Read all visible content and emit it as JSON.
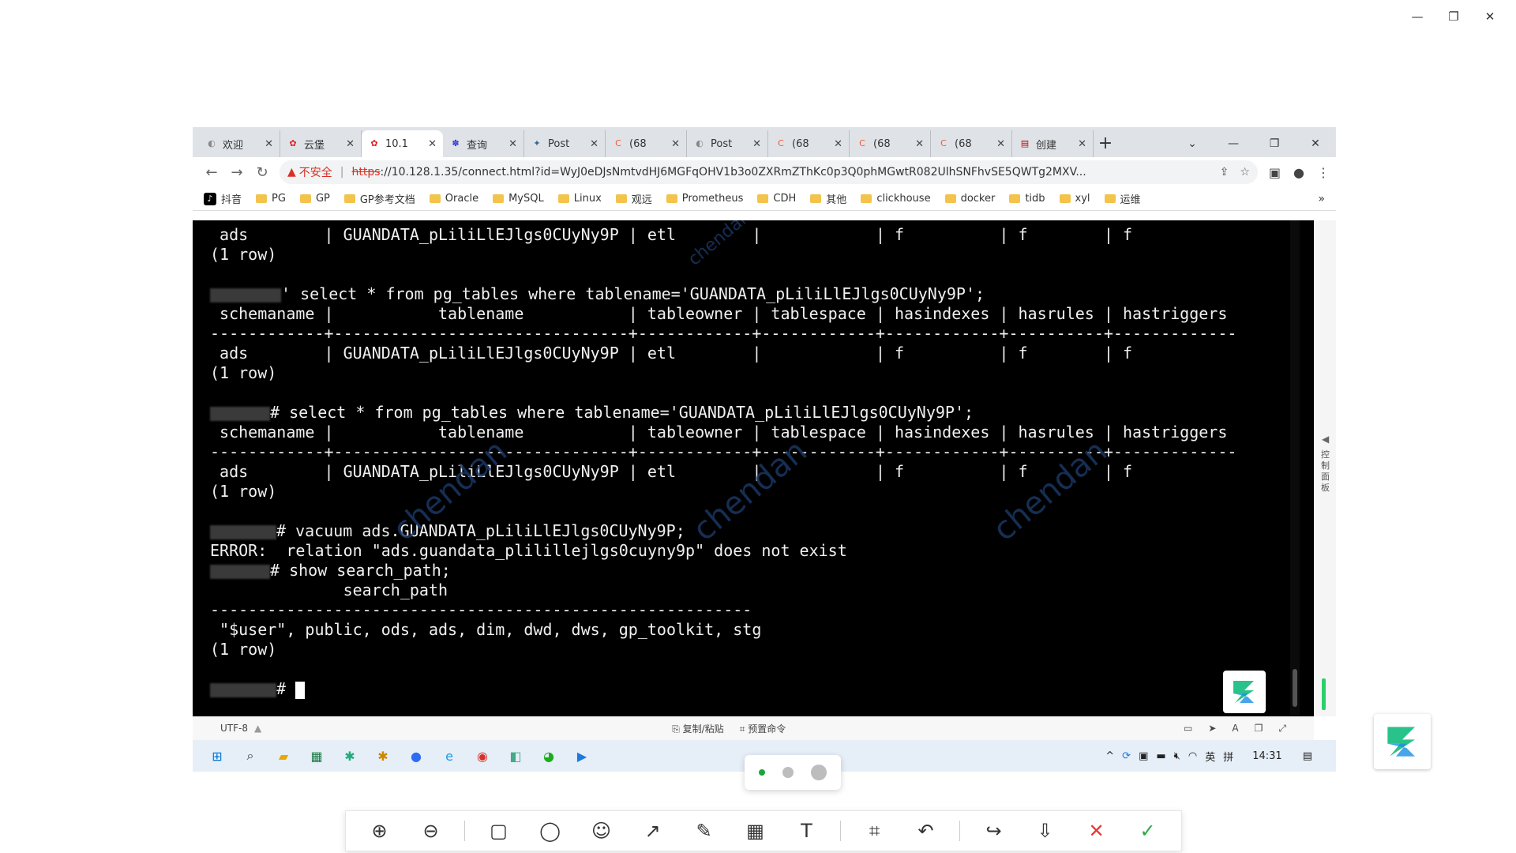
{
  "window_controls": {
    "minimize": "—",
    "restore": "❐",
    "close": "✕"
  },
  "tabs": [
    {
      "title": "欢迎",
      "active": false,
      "favicon": "globe-icon"
    },
    {
      "title": "云堡",
      "active": false,
      "favicon": "huawei-icon"
    },
    {
      "title": "10.1",
      "active": true,
      "favicon": "huawei-icon"
    },
    {
      "title": "查询",
      "active": false,
      "favicon": "baidu-icon"
    },
    {
      "title": "Post",
      "active": false,
      "favicon": "postgres-icon"
    },
    {
      "title": "(68",
      "active": false,
      "favicon": "csdn-icon"
    },
    {
      "title": "Post",
      "active": false,
      "favicon": "globe-icon"
    },
    {
      "title": "(68",
      "active": false,
      "favicon": "csdn-icon"
    },
    {
      "title": "(68",
      "active": false,
      "favicon": "csdn-icon"
    },
    {
      "title": "(68",
      "active": false,
      "favicon": "csdn-icon"
    },
    {
      "title": "创建",
      "active": false,
      "favicon": "app-icon"
    }
  ],
  "address": {
    "warning": "▲",
    "insecure": "不安全",
    "scheme": "https",
    "rest": "://10.128.1.35/connect.html?id=WyJ0eDJsNmtvdHJ6MGFqOHV1b3o0ZXRmZThKc0p3Q0phMGwtR082UlhSNFhvSE5QWTg2MXV..."
  },
  "bookmarks": [
    {
      "label": "抖音",
      "icon": "tiktok-icon"
    },
    {
      "label": "PG",
      "icon": "folder-icon"
    },
    {
      "label": "GP",
      "icon": "folder-icon"
    },
    {
      "label": "GP参考文档",
      "icon": "folder-icon"
    },
    {
      "label": "Oracle",
      "icon": "folder-icon"
    },
    {
      "label": "MySQL",
      "icon": "folder-icon"
    },
    {
      "label": "Linux",
      "icon": "folder-icon"
    },
    {
      "label": "观远",
      "icon": "folder-icon"
    },
    {
      "label": "Prometheus",
      "icon": "folder-icon"
    },
    {
      "label": "CDH",
      "icon": "folder-icon"
    },
    {
      "label": "其他",
      "icon": "folder-icon"
    },
    {
      "label": "clickhouse",
      "icon": "folder-icon"
    },
    {
      "label": "docker",
      "icon": "folder-icon"
    },
    {
      "label": "tidb",
      "icon": "folder-icon"
    },
    {
      "label": "xyl",
      "icon": "folder-icon"
    },
    {
      "label": "运维",
      "icon": "folder-icon"
    }
  ],
  "bookmarks_more": "»",
  "terminal": {
    "lines": [
      " ads        | GUANDATA_pLiliLlEJlgs0CUyNy9P | etl        |            | f          | f        | f",
      "(1 row)",
      "",
      "{{mask:90}}' select * from pg_tables where tablename='GUANDATA_pLiliLlEJlgs0CUyNy9P';",
      " schemaname |           tablename           | tableowner | tablespace | hasindexes | hasrules | hastriggers",
      "------------+-------------------------------+------------+------------+------------+----------+-------------",
      " ads        | GUANDATA_pLiliLlEJlgs0CUyNy9P | etl        |            | f          | f        | f",
      "(1 row)",
      "",
      "{{mask:76}}# select * from pg_tables where tablename='GUANDATA_pLiliLlEJlgs0CUyNy9P';",
      " schemaname |           tablename           | tableowner | tablespace | hasindexes | hasrules | hastriggers",
      "------------+-------------------------------+------------+------------+------------+----------+-------------",
      " ads        | GUANDATA_pLiliLlEJlgs0CUyNy9P | etl        |            | f          | f        | f",
      "(1 row)",
      "",
      "{{mask:84}}# vacuum ads.GUANDATA_pLiliLlEJlgs0CUyNy9P;",
      "ERROR:  relation \"ads.guandata_plilillejlgs0cuyny9p\" does not exist",
      "{{mask:76}}# show search_path;",
      "              search_path",
      "---------------------------------------------------------",
      " \"$user\", public, ods, ads, dim, dwd, dws, gp_toolkit, stg",
      "(1 row)",
      "",
      "{{mask:84}}# {{cursor}}"
    ],
    "watermark": "chendan"
  },
  "side_panel_label": "控制面板",
  "status_bar": {
    "encoding": "UTF-8",
    "copy_paste": "复制/粘贴",
    "preset_cmd": "预置命令"
  },
  "taskbar": {
    "time": "14:31",
    "ime": "英",
    "ime2": "拼"
  },
  "screenshot_tools": [
    "zoom-in-icon",
    "zoom-out-icon",
    "|",
    "rectangle-icon",
    "circle-icon",
    "emoji-icon",
    "arrow-icon",
    "pen-icon",
    "mosaic-icon",
    "text-icon",
    "|",
    "crop-icon",
    "undo-icon",
    "|",
    "share-icon",
    "download-icon",
    "cancel-icon",
    "confirm-icon"
  ]
}
